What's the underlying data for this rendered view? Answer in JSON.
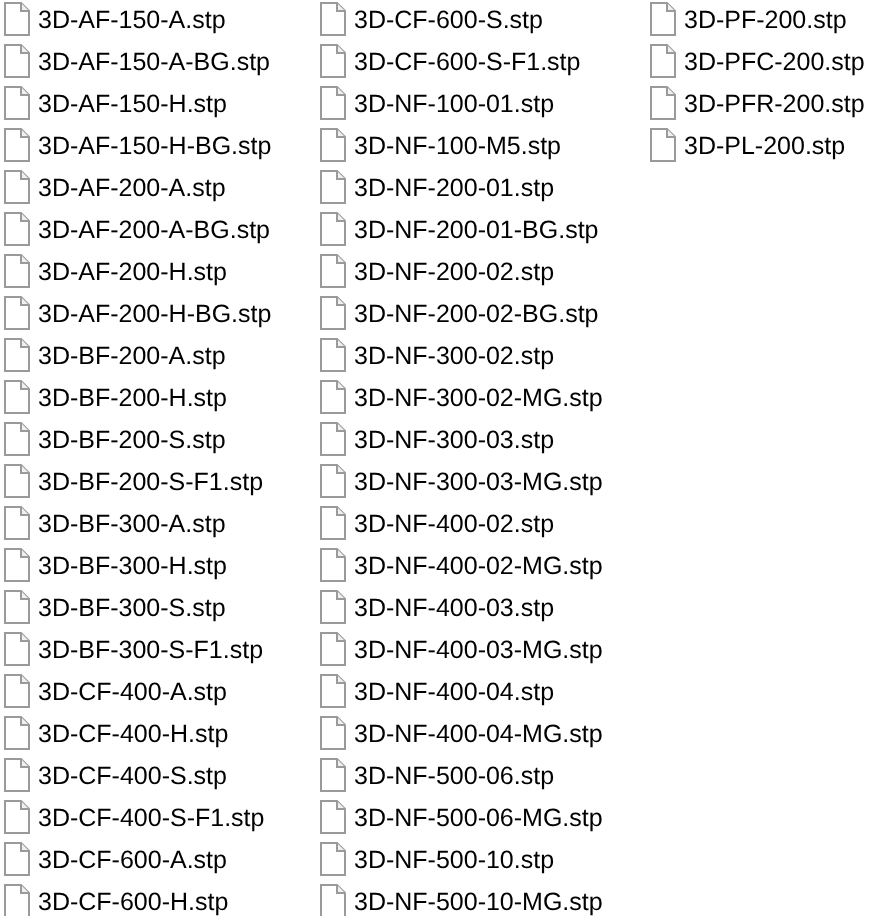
{
  "files": [
    "3D-AF-150-A.stp",
    "3D-AF-150-A-BG.stp",
    "3D-AF-150-H.stp",
    "3D-AF-150-H-BG.stp",
    "3D-AF-200-A.stp",
    "3D-AF-200-A-BG.stp",
    "3D-AF-200-H.stp",
    "3D-AF-200-H-BG.stp",
    "3D-BF-200-A.stp",
    "3D-BF-200-H.stp",
    "3D-BF-200-S.stp",
    "3D-BF-200-S-F1.stp",
    "3D-BF-300-A.stp",
    "3D-BF-300-H.stp",
    "3D-BF-300-S.stp",
    "3D-BF-300-S-F1.stp",
    "3D-CF-400-A.stp",
    "3D-CF-400-H.stp",
    "3D-CF-400-S.stp",
    "3D-CF-400-S-F1.stp",
    "3D-CF-600-A.stp",
    "3D-CF-600-H.stp",
    "3D-CF-600-S.stp",
    "3D-CF-600-S-F1.stp",
    "3D-NF-100-01.stp",
    "3D-NF-100-M5.stp",
    "3D-NF-200-01.stp",
    "3D-NF-200-01-BG.stp",
    "3D-NF-200-02.stp",
    "3D-NF-200-02-BG.stp",
    "3D-NF-300-02.stp",
    "3D-NF-300-02-MG.stp",
    "3D-NF-300-03.stp",
    "3D-NF-300-03-MG.stp",
    "3D-NF-400-02.stp",
    "3D-NF-400-02-MG.stp",
    "3D-NF-400-03.stp",
    "3D-NF-400-03-MG.stp",
    "3D-NF-400-04.stp",
    "3D-NF-400-04-MG.stp",
    "3D-NF-500-06.stp",
    "3D-NF-500-06-MG.stp",
    "3D-NF-500-10.stp",
    "3D-NF-500-10-MG.stp",
    "3D-PF-200.stp",
    "3D-PFC-200.stp",
    "3D-PFR-200.stp",
    "3D-PL-200.stp"
  ]
}
